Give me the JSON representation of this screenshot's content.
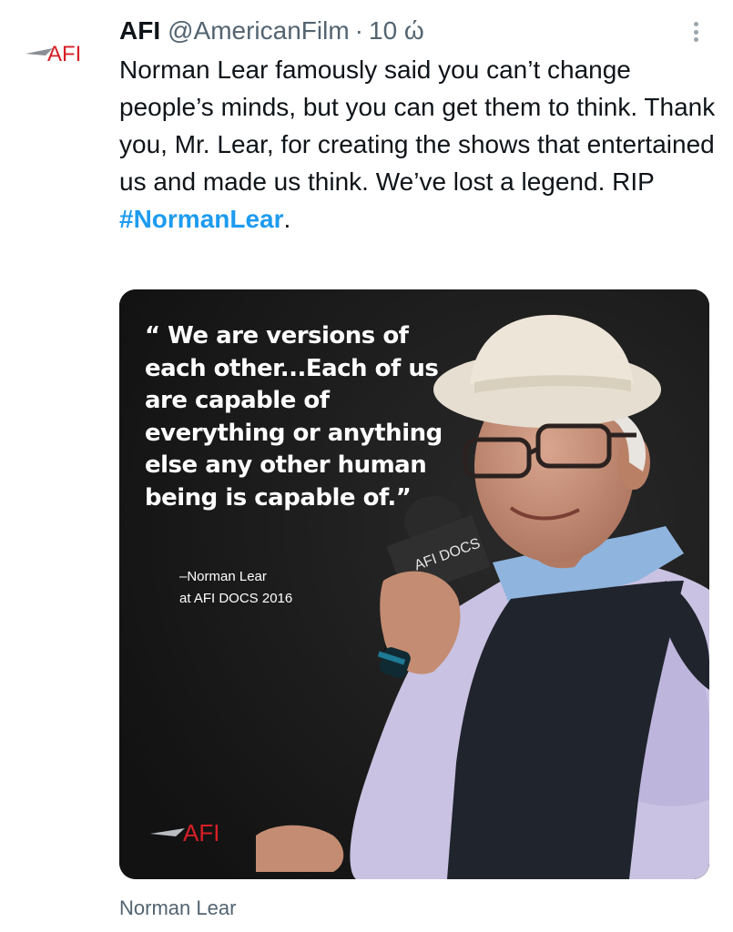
{
  "author": {
    "avatar_logo_text": "AFI",
    "display_name": "AFI",
    "handle": "@AmericanFilm",
    "separator": "·",
    "time": "10 ώ"
  },
  "tweet": {
    "text": "Norman Lear famously said you can’t change people’s minds, but you can get them to think. Thank you, Mr. Lear, for creating the shows that entertained us and made us think. We’ve lost a legend. RIP",
    "hashtag": "#NormanLear",
    "trailing": "."
  },
  "media": {
    "quote": "“ We are versions of each other...Each of us are capable of everything or anything else any other human being is capable of.”",
    "attribution_line1": "–Norman Lear",
    "attribution_line2": "at AFI DOCS 2016",
    "logo_text": "AFI",
    "mic_flag_text": "AFI DOCS"
  },
  "caption": "Norman Lear",
  "colors": {
    "link": "#1d9bf0",
    "secondary_text": "#536471",
    "afi_red": "#d71f26"
  },
  "icons": {
    "more": "more-vertical-icon"
  }
}
